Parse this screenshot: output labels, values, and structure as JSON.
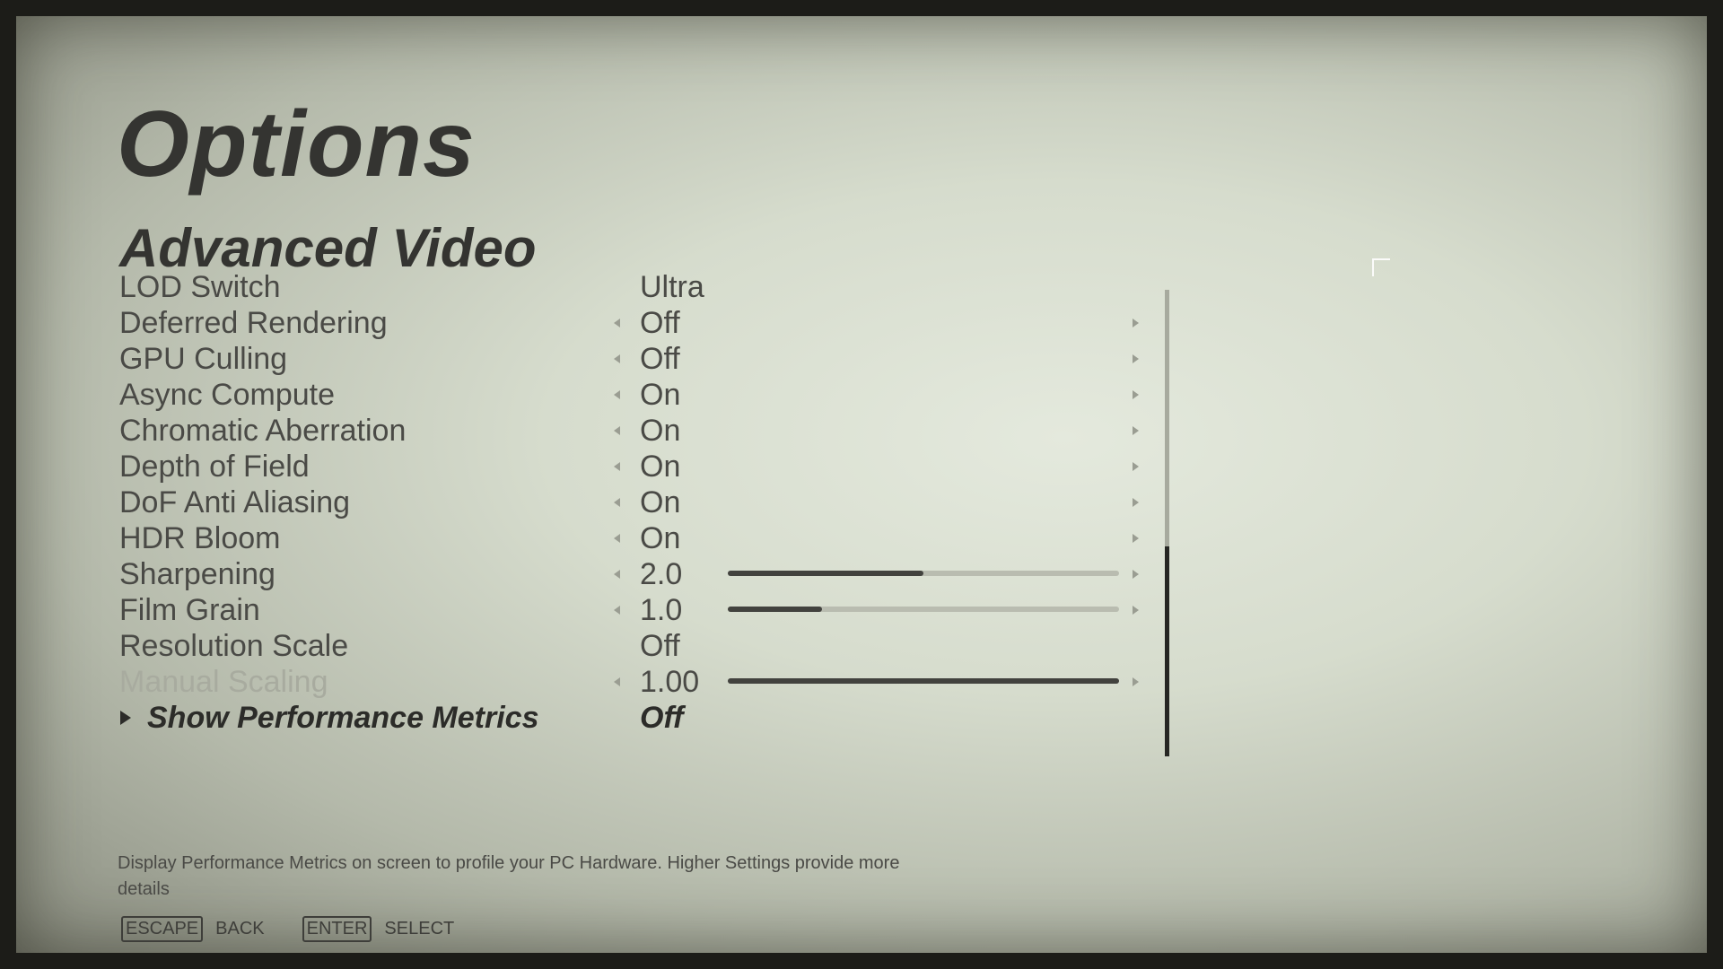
{
  "title": "Options",
  "subtitle": "Advanced Video",
  "settings": [
    {
      "label": "LOD Switch",
      "value": "Ultra",
      "arrows": false
    },
    {
      "label": "Deferred Rendering",
      "value": "Off",
      "arrows": true
    },
    {
      "label": "GPU Culling",
      "value": "Off",
      "arrows": true
    },
    {
      "label": "Async Compute",
      "value": "On",
      "arrows": true
    },
    {
      "label": "Chromatic Aberration",
      "value": "On",
      "arrows": true
    },
    {
      "label": "Depth of Field",
      "value": "On",
      "arrows": true
    },
    {
      "label": "DoF Anti Aliasing",
      "value": "On",
      "arrows": true
    },
    {
      "label": "HDR Bloom",
      "value": "On",
      "arrows": true
    },
    {
      "label": "Sharpening",
      "value": "2.0",
      "arrows": true,
      "slider_fraction": 0.5
    },
    {
      "label": "Film Grain",
      "value": "1.0",
      "arrows": true,
      "slider_fraction": 0.24
    },
    {
      "label": "Resolution Scale",
      "value": "Off",
      "arrows": false
    },
    {
      "label": "Manual Scaling",
      "value": "1.00",
      "arrows": true,
      "slider_fraction": 1.0,
      "disabled": true
    },
    {
      "label": "Show Performance Metrics",
      "value": "Off",
      "arrows": false,
      "selected": true
    }
  ],
  "scrollbar": {
    "thumb_start_fraction": 0.55,
    "thumb_end_fraction": 1.0
  },
  "help_text": "Display Performance Metrics on screen to profile your PC Hardware. Higher Settings provide more details",
  "hints": [
    {
      "key": "ESCAPE",
      "action": "BACK"
    },
    {
      "key": "ENTER",
      "action": "SELECT"
    }
  ]
}
